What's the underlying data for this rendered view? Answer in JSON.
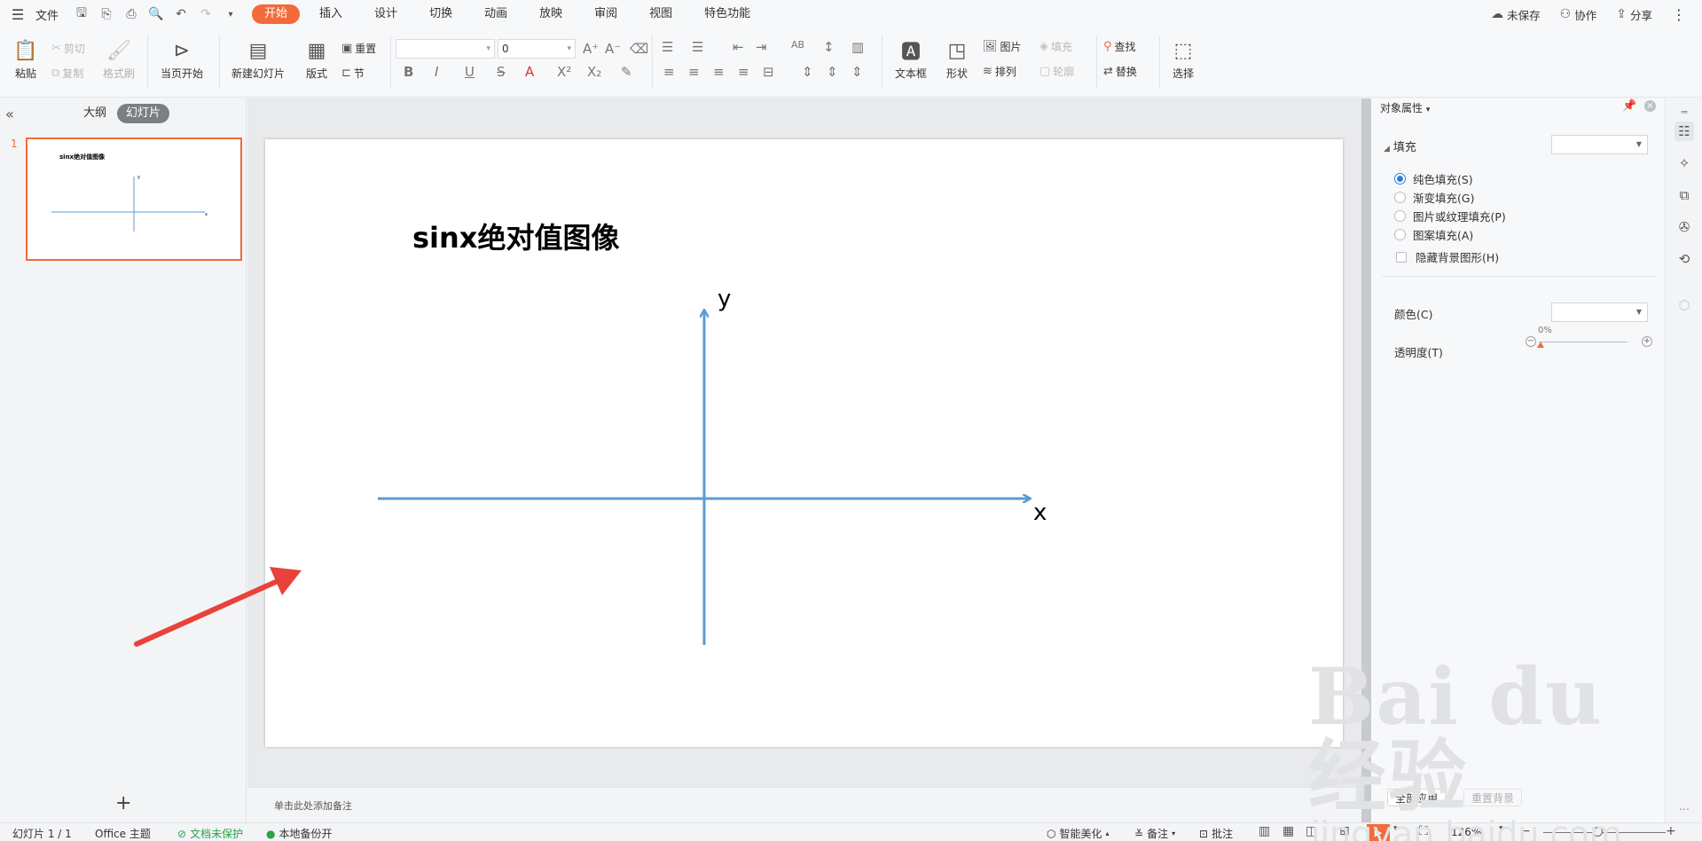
{
  "menubar": {
    "file_label": "文件",
    "tabs": [
      {
        "label": "开始",
        "active": true
      },
      {
        "label": "插入"
      },
      {
        "label": "设计"
      },
      {
        "label": "切换"
      },
      {
        "label": "动画"
      },
      {
        "label": "放映"
      },
      {
        "label": "审阅"
      },
      {
        "label": "视图"
      },
      {
        "label": "特色功能"
      }
    ],
    "right": {
      "unsaved": "未保存",
      "collaborate": "协作",
      "share": "分享"
    }
  },
  "ribbon": {
    "paste": "粘贴",
    "cut": "剪切",
    "copy": "复制",
    "format_painter": "格式刷",
    "from_current": "当页开始",
    "new_slide": "新建幻灯片",
    "layout": "版式",
    "reset": "重置",
    "section": "节",
    "font_name": "",
    "font_size": "0",
    "text_box": "文本框",
    "shape": "形状",
    "picture": "图片",
    "fill": "填充",
    "arrange": "排列",
    "outline": "轮廓",
    "find": "查找",
    "replace": "替换",
    "select": "选择"
  },
  "leftpane": {
    "tab_outline": "大纲",
    "tab_slides": "幻灯片",
    "slide_number": "1",
    "thumb_title": "sinx绝对值图像",
    "thumb_y": "y",
    "thumb_x": "x"
  },
  "slide": {
    "title": "sinx绝对值图像",
    "axis_y_label": "y",
    "axis_x_label": "x",
    "axis_color": "#5b9bd5",
    "arrow_color": "#e8423a"
  },
  "notes": {
    "placeholder": "单击此处添加备注"
  },
  "rightpanel": {
    "title": "对象属性",
    "fill_section": "填充",
    "options": [
      {
        "label": "纯色填充(S)",
        "selected": true
      },
      {
        "label": "渐变填充(G)",
        "selected": false
      },
      {
        "label": "图片或纹理填充(P)",
        "selected": false
      },
      {
        "label": "图案填充(A)",
        "selected": false
      }
    ],
    "hide_bg": "隐藏背景图形(H)",
    "color_label": "颜色(C)",
    "transparency_label": "透明度(T)",
    "transparency_value": "0%",
    "apply_all": "全部应用",
    "reset_bg": "重置背景"
  },
  "statusbar": {
    "slide_info": "幻灯片 1 / 1",
    "theme": "Office 主题",
    "protect": "文档未保护",
    "backup": "本地备份开",
    "beautify": "智能美化",
    "notes": "备注",
    "comment": "批注",
    "zoom": "126%"
  },
  "watermark": {
    "brand": "Bai du 经验",
    "url": "jingyan.baidu.com"
  }
}
